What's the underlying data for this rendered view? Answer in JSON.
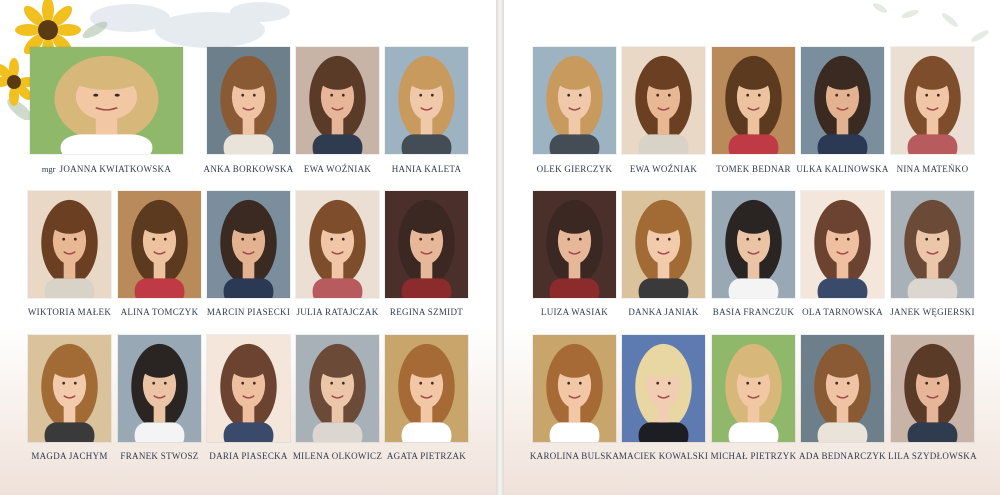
{
  "teacher": {
    "prefix": "mgr",
    "name": "JOANNA KWIATKOWSKA"
  },
  "left_page": [
    "ANKA BORKOWSKA",
    "EWA WOŹNIAK",
    "HANIA KALETA",
    "WIKTORIA MAŁEK",
    "ALINA TOMCZYK",
    "MARCIN PIASECKI",
    "JULIA RATAJCZAK",
    "REGINA SZMIDT",
    "MAGDA JACHYM",
    "FRANEK STWOSZ",
    "DARIA PIASECKA",
    "MILENA OLKOWICZ",
    "AGATA PIETRZAK"
  ],
  "right_page": [
    "OLEK GIERCZYK",
    "EWA WOŹNIAK",
    "TOMEK BEDNAR",
    "ULKA KALINOWSKA",
    "NINA MATEŃKO",
    "LUIZA WASIAK",
    "DANKA JANIAK",
    "BASIA FRANCZUK",
    "OLA TARNOWSKA",
    "JANEK WĘGIERSKI",
    "KAROLINA BULSKA",
    "MACIEK KOWALSKI",
    "MICHAŁ PIETRZYK",
    "ADA BEDNARCZYK",
    "LILA SZYDŁOWSKA"
  ],
  "colors": {
    "name_text": "#2e3a4e",
    "page": "#ffffff",
    "accent_flower": "#f2c01e"
  }
}
